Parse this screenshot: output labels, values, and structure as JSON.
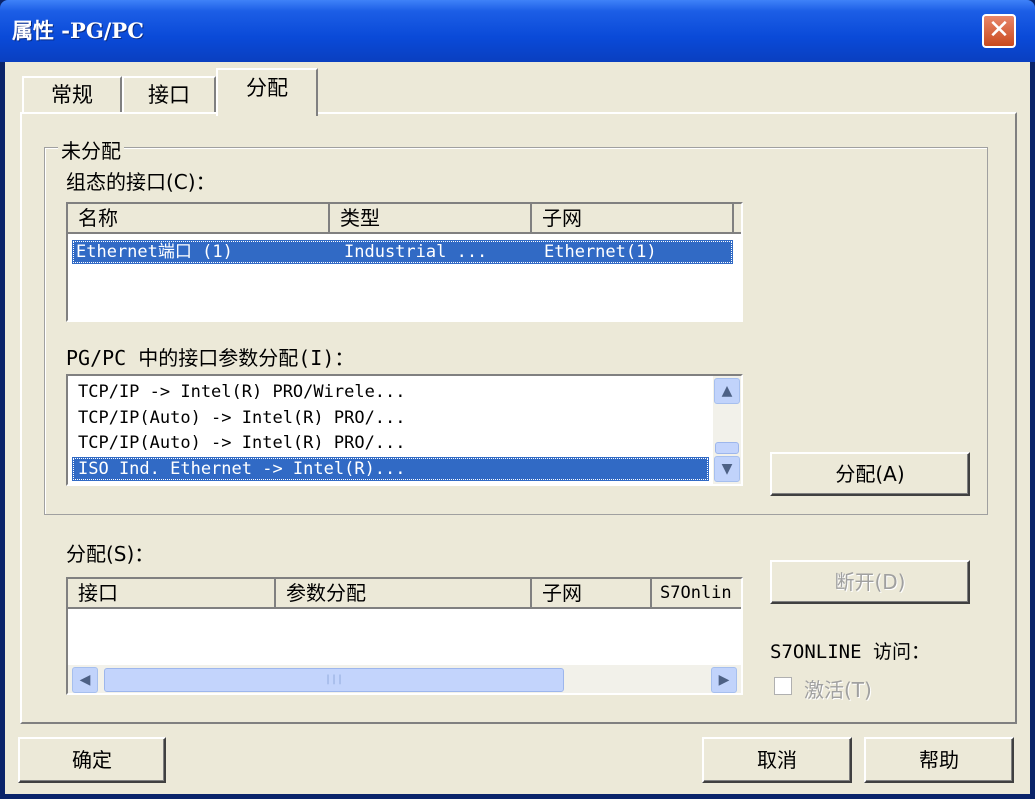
{
  "window": {
    "title": "属性 -PG/PC",
    "close_glyph": "✕"
  },
  "tabs": [
    {
      "label": "常规"
    },
    {
      "label": "接口"
    },
    {
      "label": "分配"
    }
  ],
  "unassigned": {
    "group_label": "未分配",
    "configured_label": "组态的接口(C)：",
    "configured_columns": [
      "名称",
      "类型",
      "子网"
    ],
    "configured_rows": [
      {
        "name": "Ethernet端口 (1)",
        "type": "Industrial ...",
        "subnet": "Ethernet(1)",
        "selected": true
      }
    ],
    "param_label": "PG/PC 中的接口参数分配(I)：",
    "param_rows": [
      {
        "text": "TCP/IP -> Intel(R) PRO/Wirele...",
        "selected": false
      },
      {
        "text": "TCP/IP(Auto) -> Intel(R) PRO/...",
        "selected": false
      },
      {
        "text": "TCP/IP(Auto) -> Intel(R) PRO/...",
        "selected": false
      },
      {
        "text": "ISO Ind. Ethernet -> Intel(R)...",
        "selected": true
      }
    ],
    "assign_button": "分配(A)"
  },
  "assigned": {
    "label": "分配(S)：",
    "columns": [
      "接口",
      "参数分配",
      "子网",
      "S7Onlin"
    ],
    "hscroll_thumb_glyph": "|||",
    "disconnect_button": "断开(D)",
    "s7online_label": "S7ONLINE 访问：",
    "activate_label": "激活(T)",
    "activate_checked": false
  },
  "footer": {
    "ok": "确定",
    "cancel": "取消",
    "help": "帮助"
  },
  "colors": {
    "selection": "#316ac5",
    "titlebar": "#0a4ad8",
    "face": "#ece9d8"
  }
}
